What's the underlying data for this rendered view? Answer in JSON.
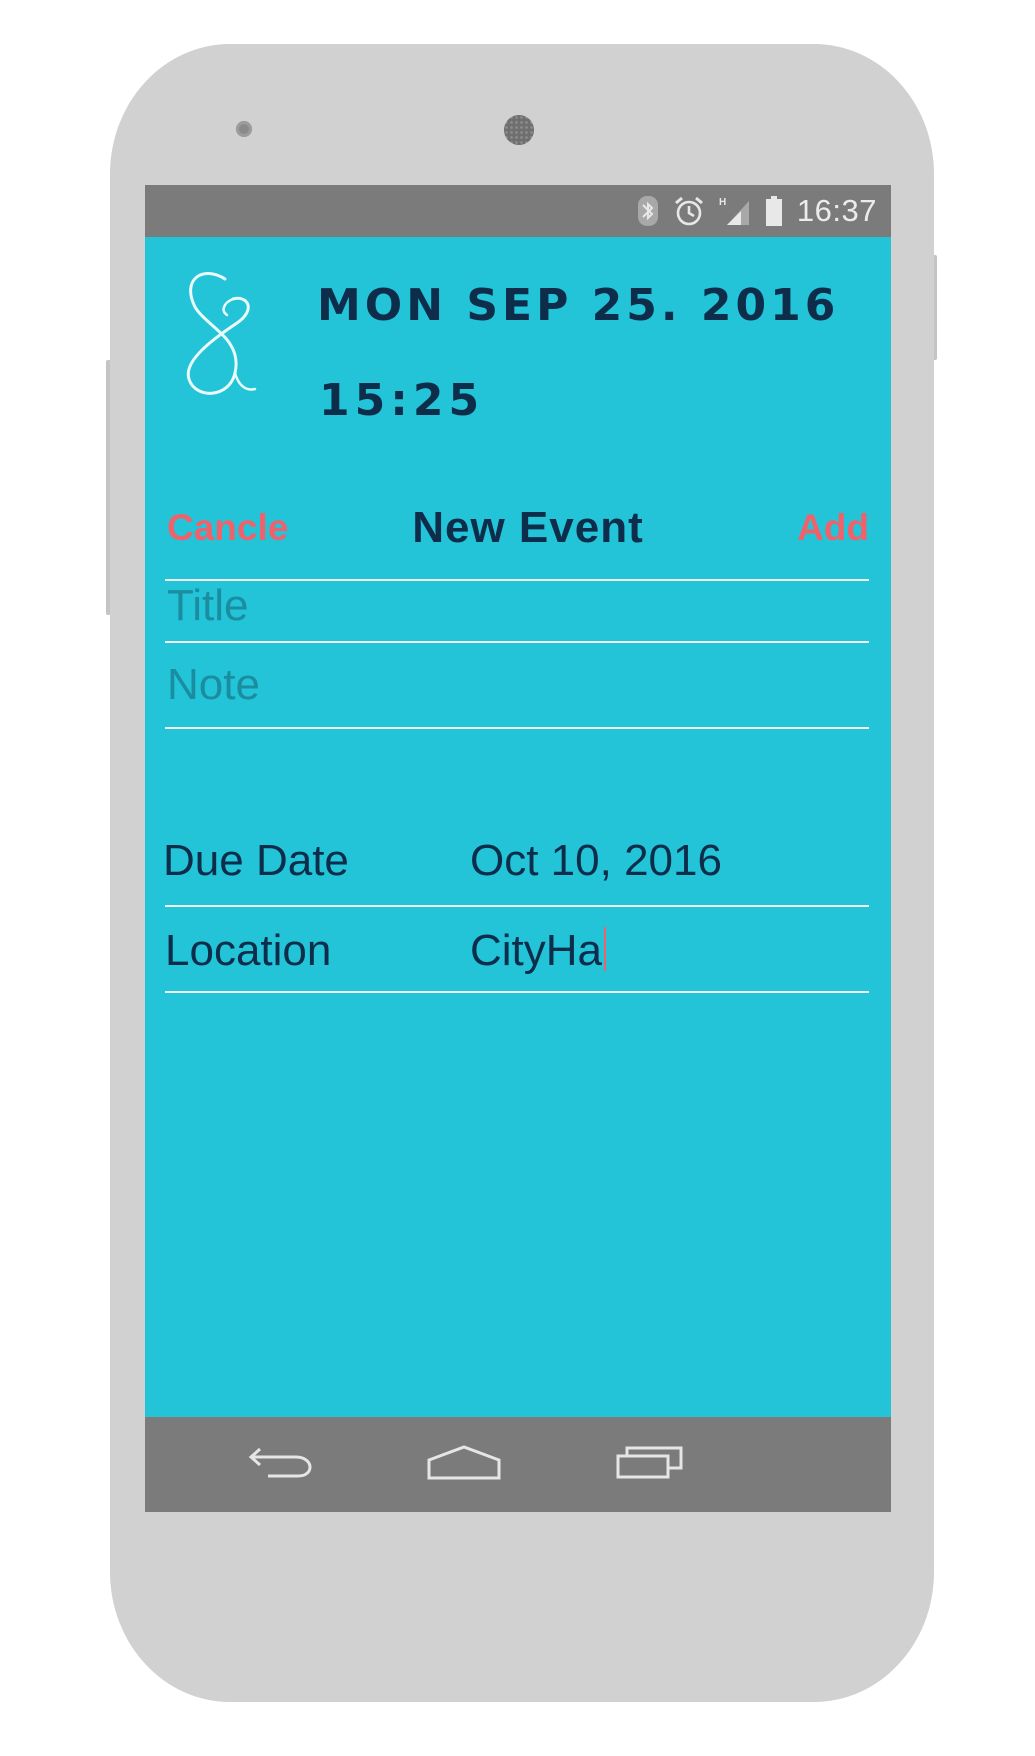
{
  "status_bar": {
    "time": "16:37",
    "icons": [
      "bluetooth-icon",
      "alarm-icon",
      "signal-icon",
      "battery-icon"
    ]
  },
  "header": {
    "date": "MON SEP 25. 2016",
    "time": "15:25",
    "logo_glyph": "8"
  },
  "action_bar": {
    "cancel_label": "Cancle",
    "title": "New Event",
    "add_label": "Add"
  },
  "form": {
    "title_placeholder": "Title",
    "title_value": "",
    "note_placeholder": "Note",
    "note_value": "",
    "due_date_label": "Due Date",
    "due_date_value": "Oct 10, 2016",
    "location_label": "Location",
    "location_value": "CityHa"
  },
  "nav_bar": {
    "icons": [
      "back-icon",
      "home-icon",
      "recent-apps-icon"
    ]
  },
  "colors": {
    "screen_bg": "#23c3d8",
    "text_dark": "#0d2d4a",
    "accent": "#f0626b",
    "system_bar": "#7b7b7b",
    "phone_shell": "#d1d1d1"
  }
}
